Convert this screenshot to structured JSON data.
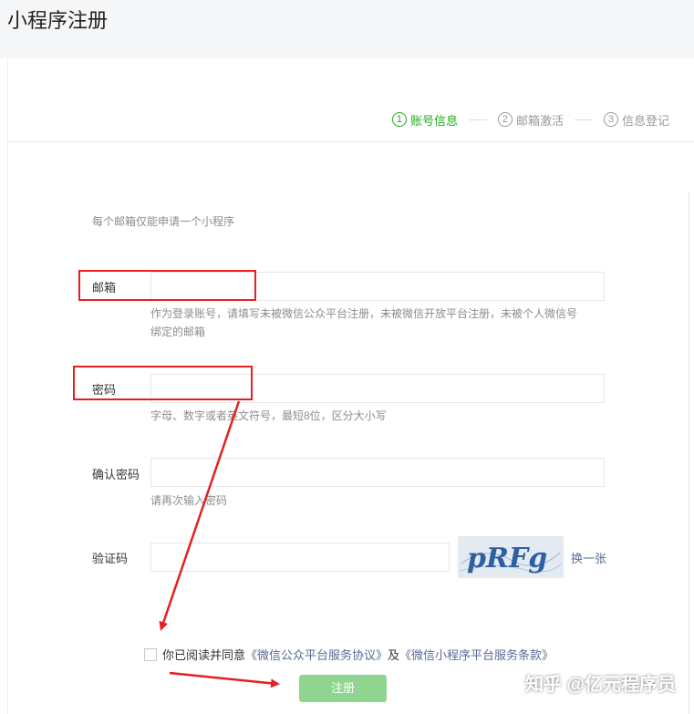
{
  "page": {
    "title": "小程序注册"
  },
  "steps": [
    {
      "num": "1",
      "label": "账号信息"
    },
    {
      "num": "2",
      "label": "邮箱激活"
    },
    {
      "num": "3",
      "label": "信息登记"
    }
  ],
  "notice": "每个邮箱仅能申请一个小程序",
  "form": {
    "email": {
      "label": "邮箱",
      "value": "",
      "tip_line1": "作为登录账号，请填写未被微信公众平台注册，未被微信开放平台注册，未被个人微信号",
      "tip_line2": "绑定的邮箱"
    },
    "password": {
      "label": "密码",
      "value": "",
      "tip": "字母、数字或者英文符号，最短8位，区分大小写"
    },
    "confirm": {
      "label": "确认密码",
      "value": "",
      "tip": "请再次输入密码"
    },
    "captcha": {
      "label": "验证码",
      "value": "",
      "image_text": "pRFg",
      "refresh": "换一张"
    }
  },
  "agreement": {
    "prefix": "你已阅读并同意",
    "link1": "《微信公众平台服务协议》",
    "middle": "及",
    "link2": "《微信小程序平台服务条款》",
    "checked": false
  },
  "register_button": "注册",
  "watermark": "知乎 @亿元程序员",
  "colors": {
    "accent_green": "#1aad19",
    "button_disabled": "#8fd58f",
    "link_blue": "#576b95",
    "annotation_red": "#e52020"
  }
}
